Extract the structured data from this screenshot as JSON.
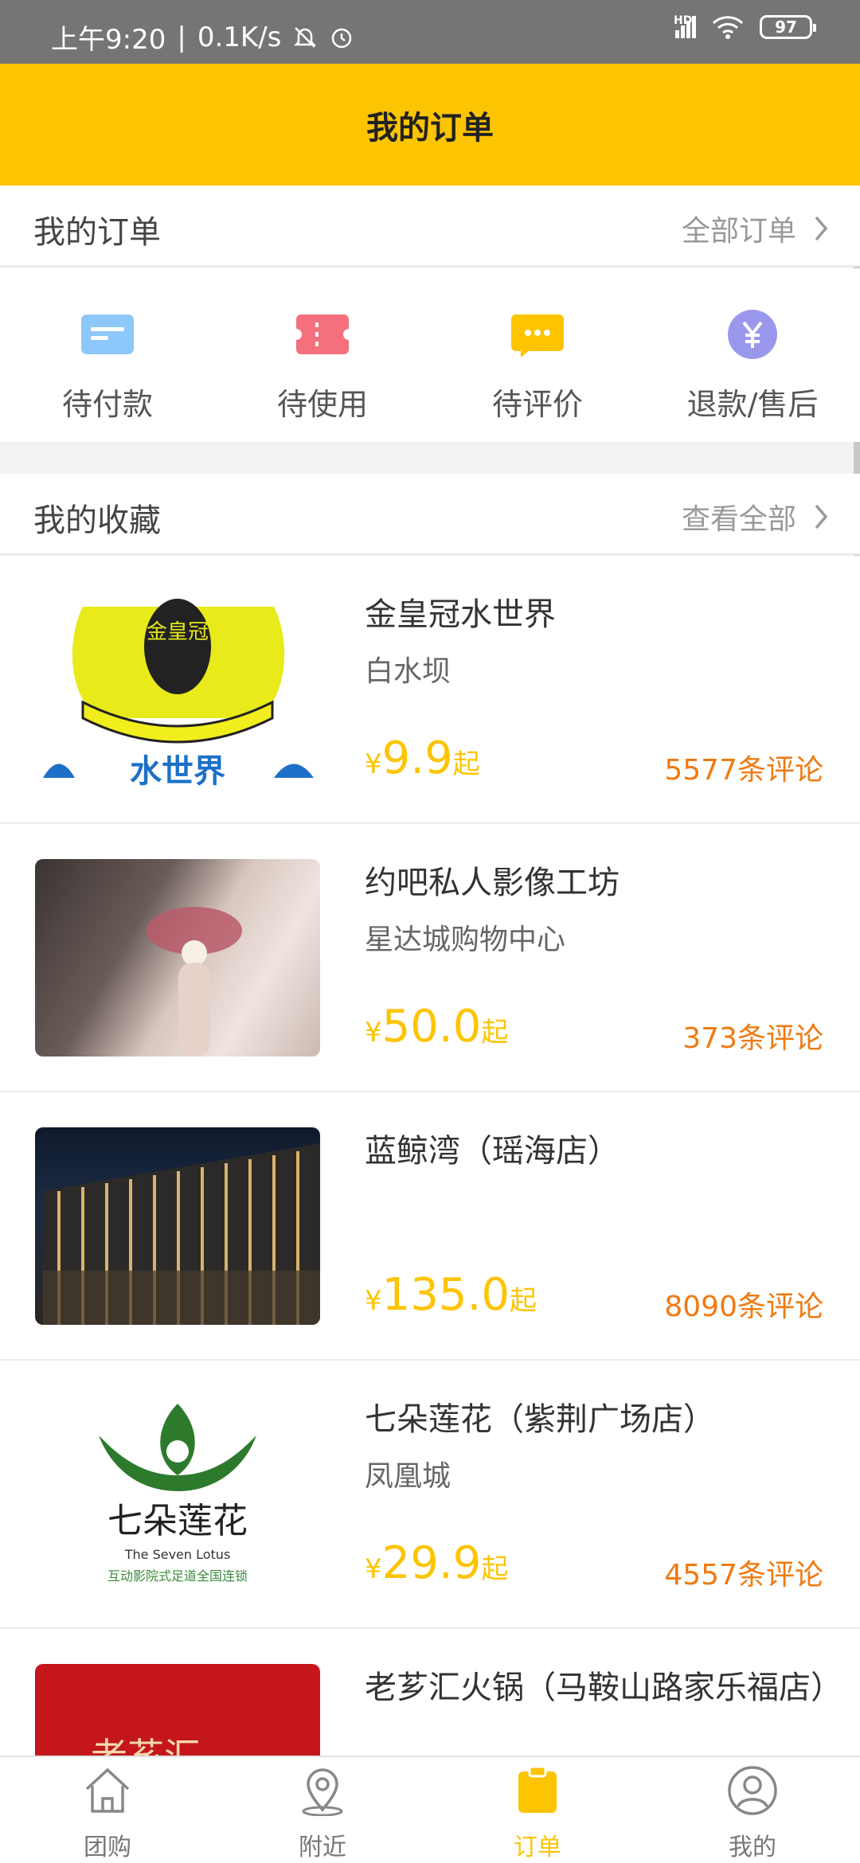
{
  "status_bar": {
    "time": "上午9:20",
    "separator": "|",
    "speed": "0.1K/s",
    "network": "HD",
    "battery": "97"
  },
  "header": {
    "title": "我的订单"
  },
  "orders_section": {
    "title": "我的订单",
    "more_label": "全部订单",
    "items": [
      {
        "label": "待付款",
        "icon": "card-icon",
        "color": "#8ec8fa"
      },
      {
        "label": "待使用",
        "icon": "ticket-icon",
        "color": "#f4707c"
      },
      {
        "label": "待评价",
        "icon": "chat-bubble-icon",
        "color": "#fdc402"
      },
      {
        "label": "退款/售后",
        "icon": "yen-circle-icon",
        "color": "#9a98ec"
      }
    ]
  },
  "favorites_section": {
    "title": "我的收藏",
    "more_label": "查看全部",
    "items": [
      {
        "name": "金皇冠水世界",
        "area": "白水坝",
        "currency": "¥",
        "price": "9.9",
        "suffix": "起",
        "reviews": "5577条评论",
        "thumb_logo_text": "金皇冠",
        "thumb_caption": "水世界"
      },
      {
        "name": "约吧私人影像工坊",
        "area": "星达城购物中心",
        "currency": "¥",
        "price": "50.0",
        "suffix": "起",
        "reviews": "373条评论"
      },
      {
        "name": "蓝鲸湾（瑶海店）",
        "area": "",
        "currency": "¥",
        "price": "135.0",
        "suffix": "起",
        "reviews": "8090条评论"
      },
      {
        "name": "七朵莲花（紫荆广场店）",
        "area": "凤凰城",
        "currency": "¥",
        "price": "29.9",
        "suffix": "起",
        "reviews": "4557条评论",
        "thumb_logo_text": "七朵莲花",
        "thumb_logo_en": "The Seven Lotus",
        "thumb_caption": "互动影院式足道全国连锁"
      },
      {
        "name": "老芗汇火锅（马鞍山路家乐福店）",
        "area": "",
        "currency": "¥",
        "price": "",
        "suffix": "",
        "reviews": "",
        "thumb_logo_text": "老芗汇"
      }
    ]
  },
  "tab_bar": {
    "tabs": [
      {
        "label": "团购",
        "icon": "home-icon",
        "active": false
      },
      {
        "label": "附近",
        "icon": "location-pin-icon",
        "active": false
      },
      {
        "label": "订单",
        "icon": "clipboard-icon",
        "active": true
      },
      {
        "label": "我的",
        "icon": "user-icon",
        "active": false
      }
    ]
  },
  "colors": {
    "accent": "#fdc402",
    "review": "#f07a12"
  }
}
